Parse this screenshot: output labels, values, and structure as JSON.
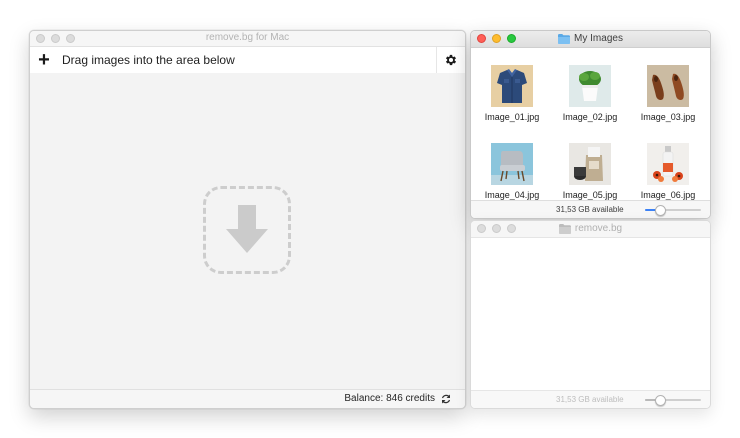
{
  "app_window": {
    "title": "remove.bg for Mac",
    "toolbar": {
      "add_icon": "plus-icon",
      "instruction": "Drag images into the area below",
      "settings_icon": "gear-icon"
    },
    "drop_zone": {
      "icon": "download-arrow-icon"
    },
    "status": {
      "balance": "Balance: 846 credits",
      "refresh_icon": "refresh-icon"
    }
  },
  "finder_my_images": {
    "title": "My Images",
    "folder_color": "#5aa9e6",
    "files": [
      {
        "name": "Image_01.jpg",
        "thumb": "shirt"
      },
      {
        "name": "Image_02.jpg",
        "thumb": "plant"
      },
      {
        "name": "Image_03.jpg",
        "thumb": "shoes"
      },
      {
        "name": "Image_04.jpg",
        "thumb": "chair"
      },
      {
        "name": "Image_05.jpg",
        "thumb": "coffee-bag"
      },
      {
        "name": "Image_06.jpg",
        "thumb": "bottle"
      }
    ],
    "status": "31,53 GB available",
    "icon_size_slider": 0.25
  },
  "finder_removebg": {
    "title": "remove.bg",
    "status": "31,53 GB available",
    "icon_size_slider": 0.25
  },
  "colors": {
    "close": "#ff5f57",
    "minimize": "#febc2e",
    "zoom": "#28c840",
    "accent": "#3c82f6"
  }
}
